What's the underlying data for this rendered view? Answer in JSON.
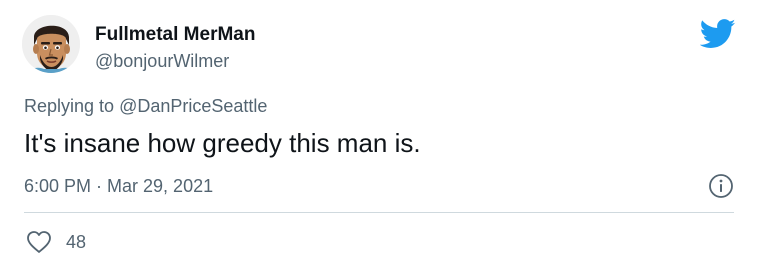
{
  "user": {
    "display_name": "Fullmetal MerMan",
    "handle": "@bonjourWilmer",
    "avatar_icon": "cartoon-man-avatar"
  },
  "reply": {
    "prefix": "Replying to",
    "mention": "@DanPriceSeattle"
  },
  "tweet": {
    "text": "It's insane how greedy this man is.",
    "timestamp": "6:00 PM · Mar 29, 2021"
  },
  "actions": {
    "like_count": "48",
    "like_icon": "heart-outline-icon",
    "info_icon": "info-icon"
  },
  "colors": {
    "brand_blue": "#1d9bf0",
    "text_primary": "#0f1419",
    "text_secondary": "#536471",
    "divider": "#cfd9de"
  }
}
